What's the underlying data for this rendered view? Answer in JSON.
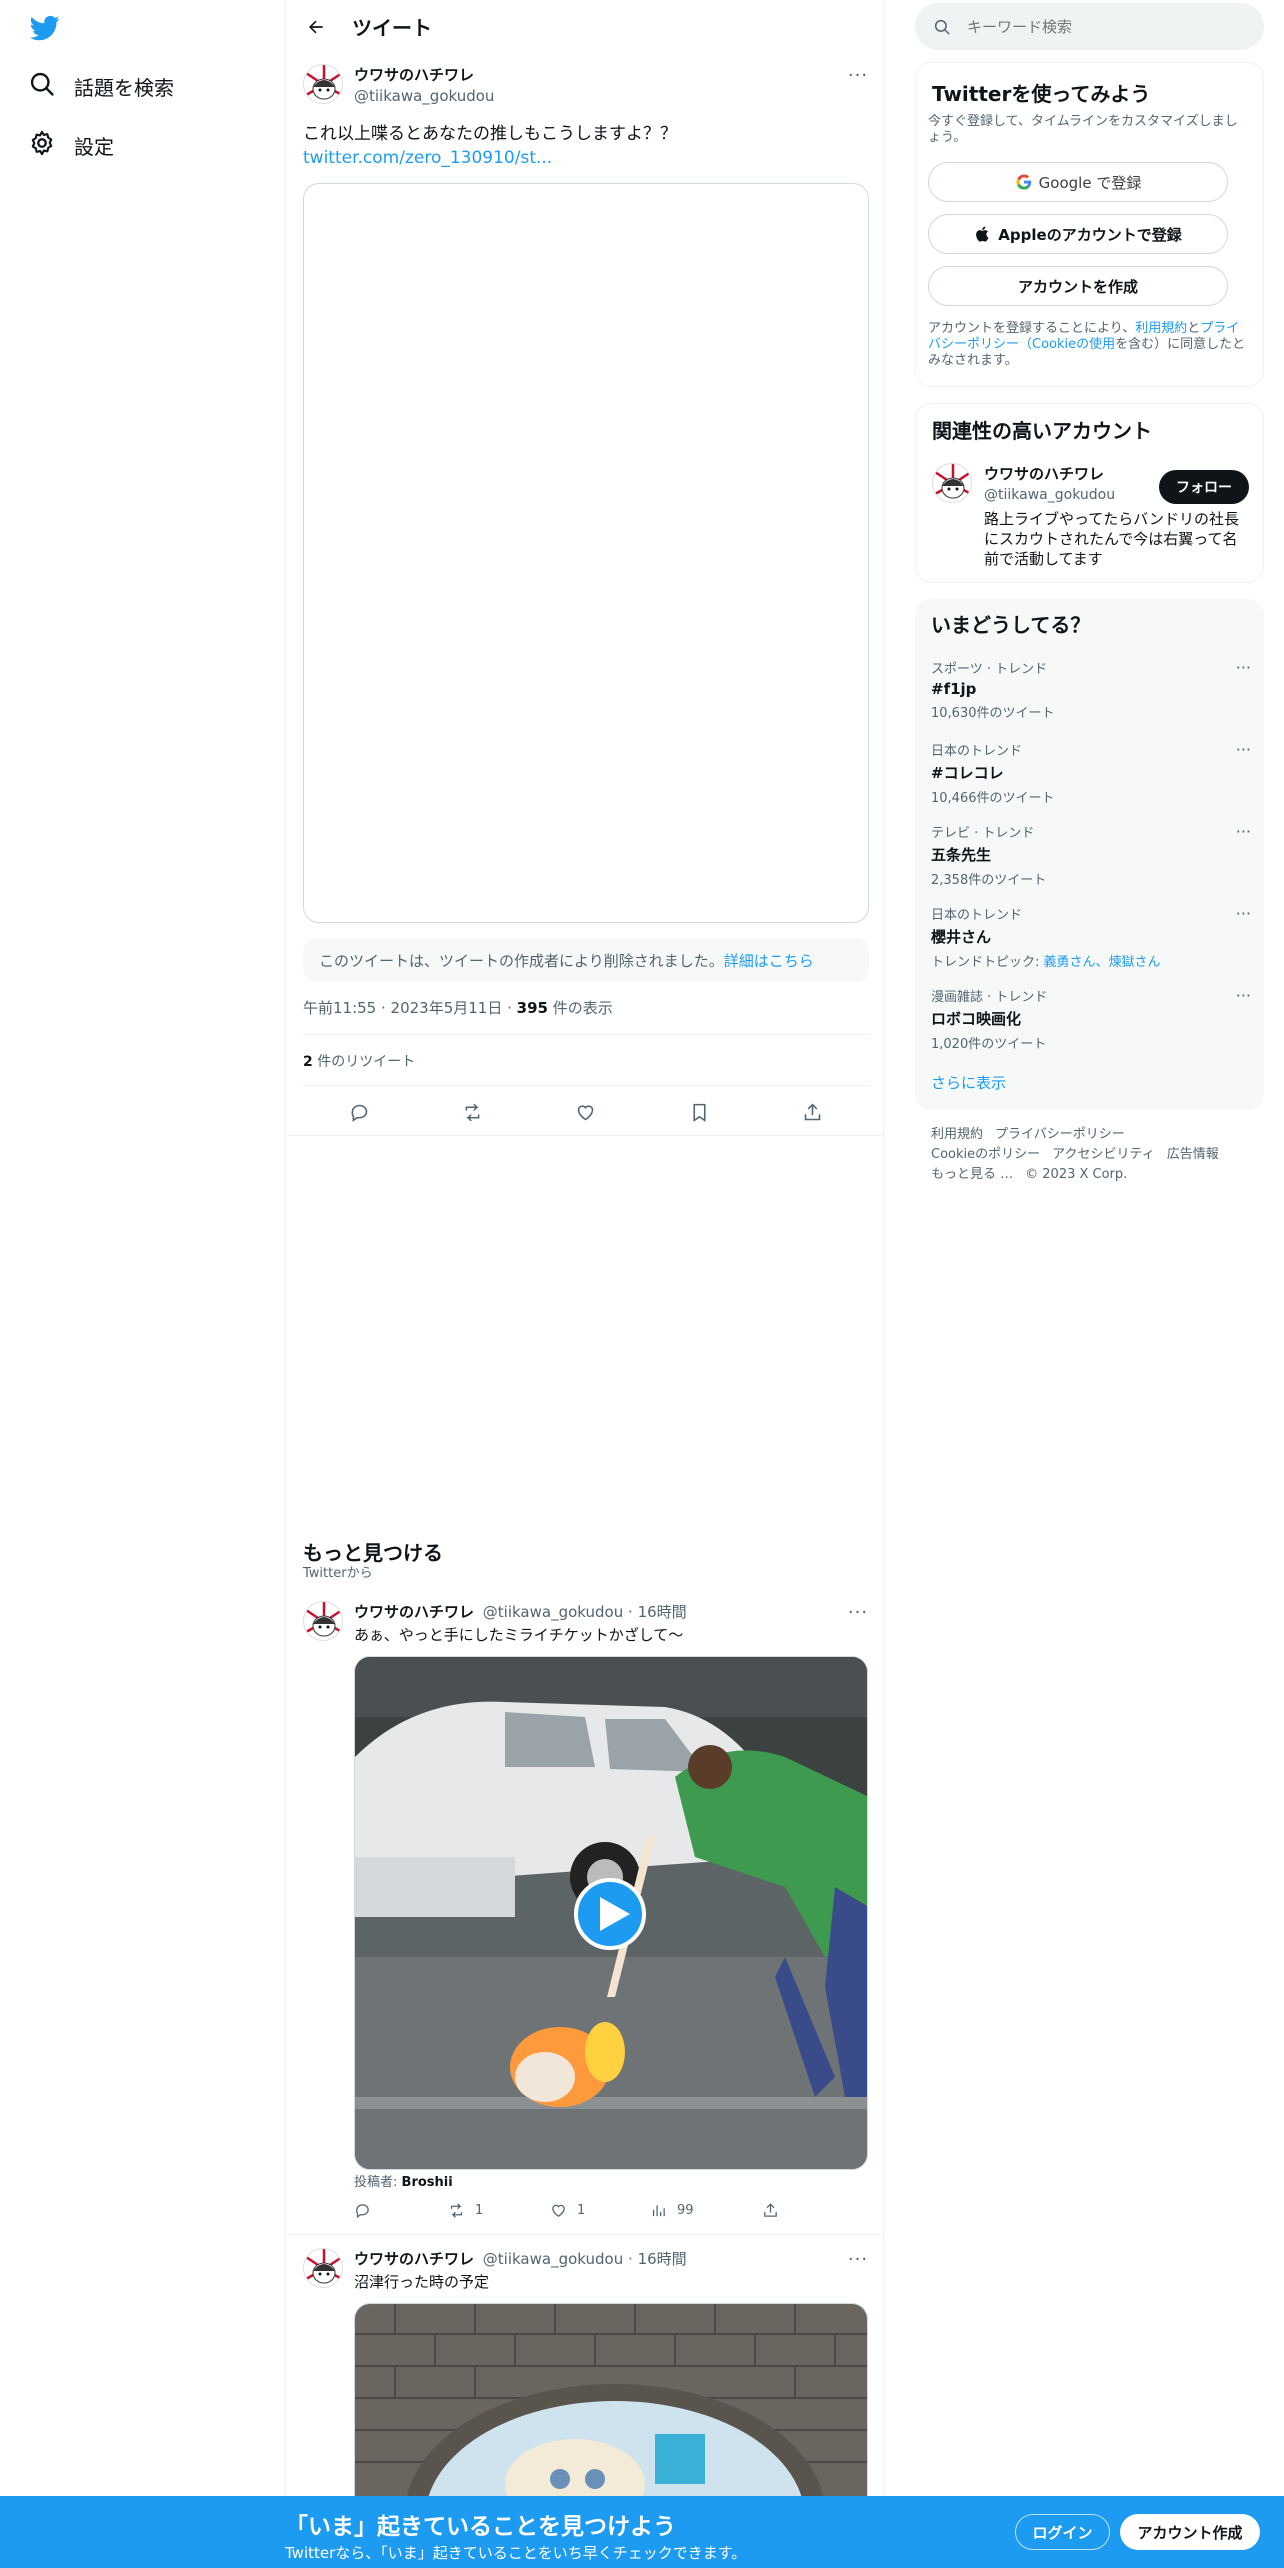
{
  "nav": {
    "items": [
      {
        "label": "話題を検索",
        "icon": "search-icon"
      },
      {
        "label": "設定",
        "icon": "gear-icon"
      }
    ]
  },
  "header": {
    "title": "ツイート"
  },
  "tweet": {
    "user_name": "ウワサのハチワレ",
    "handle": "@tiikawa_gokudou",
    "text": "これ以上喋るとあなたの推しもこうしますよ？？",
    "link": "twitter.com/zero_130910/st...",
    "deleted_notice": "このツイートは、ツイートの作成者により削除されました。",
    "deleted_link": "詳細はこちら",
    "time": "午前11:55",
    "date": "2023年5月11日",
    "views_count": "395",
    "views_label": "件の表示",
    "retweet_count": "2",
    "retweet_label": "件のリツイート"
  },
  "discover": {
    "title": "もっと見つける",
    "subtitle": "Twitterから"
  },
  "feed": [
    {
      "user_name": "ウワサのハチワレ",
      "handle": "@tiikawa_gokudou",
      "dot": "·",
      "time": "16時間",
      "text": "あぁ、やっと手にしたミライチケットかざして〜",
      "credit_label": "投稿者:",
      "credit_name": "Broshii",
      "retweets": "1",
      "likes": "1",
      "views": "99"
    },
    {
      "user_name": "ウワサのハチワレ",
      "handle": "@tiikawa_gokudou",
      "dot": "·",
      "time": "16時間",
      "text": "沼津行った時の予定"
    }
  ],
  "search": {
    "placeholder": "キーワード検索"
  },
  "signup_card": {
    "title": "Twitterを使ってみよう",
    "desc": "今すぐ登録して、タイムラインをカスタマイズしましょう。",
    "google": "Google で登録",
    "apple": "Appleのアカウントで登録",
    "create": "アカウントを作成",
    "terms_1": "アカウントを登録することにより、",
    "terms_link1": "利用規約",
    "terms_2": "と",
    "terms_link2": "プライバシーポリシー（Cookieの使用",
    "terms_3": "を含む）に同意したとみなされます。"
  },
  "related": {
    "title": "関連性の高いアカウント",
    "name": "ウワサのハチワレ",
    "handle": "@tiikawa_gokudou",
    "follow": "フォロー",
    "bio": "路上ライブやってたらバンドリの社長にスカウトされたんで今は右翼って名前で活動してます"
  },
  "trends": {
    "title": "いまどうしてる？",
    "items": [
      {
        "category": "スポーツ · トレンド",
        "name": "#f1jp",
        "count": "10,630件のツイート"
      },
      {
        "category": "日本のトレンド",
        "name": "#コレコレ",
        "count": "10,466件のツイート"
      },
      {
        "category": "テレビ · トレンド",
        "name": "五条先生",
        "count": "2,358件のツイート"
      },
      {
        "category": "日本のトレンド",
        "name": "櫻井さん",
        "topic_label": "トレンドトピック:",
        "topics": "義勇さん、煉獄さん"
      },
      {
        "category": "漫画雑誌 · トレンド",
        "name": "ロボコ映画化",
        "count": "1,020件のツイート"
      }
    ],
    "show_more": "さらに表示"
  },
  "footer": {
    "links": [
      "利用規約",
      "プライバシーポリシー",
      "Cookieのポリシー",
      "アクセシビリティ",
      "広告情報",
      "もっと見る …"
    ],
    "copyright": "© 2023 X Corp."
  },
  "bottom": {
    "title": "「いま」起きていることを見つけよう",
    "subtitle": "Twitterなら、「いま」起きていることをいち早くチェックできます。",
    "login": "ログイン",
    "signup": "アカウント作成"
  },
  "colors": {
    "accent": "#1d9bf0",
    "text": "#0f1419",
    "muted": "#536471"
  }
}
